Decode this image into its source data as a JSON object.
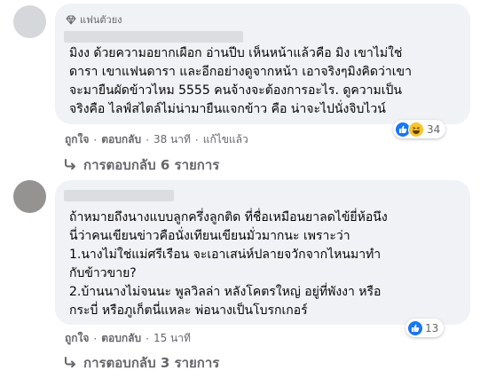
{
  "comments": [
    {
      "badge": "แฟนตัวยง",
      "lines": [
        "มิงง ด้วยความอยากเผือก อ่านปีบ เห็นหน้าแล้วคือ มิง เขาไม่ใช่",
        "ดารา เขาแฟนดารา และอีกอย่างดูจากหน้า เอาจริงๆมิงคิดว่าเขา",
        "จะมายืนผัดข้าวไหม 5555 คนจ้างจะต้องการอะไร. ดูความเป็น",
        "จริงคือ ไลฟ์สไตล์ไม่น่ามายืนแจกข้าว คือ น่าจะไปนั่งจิบไวน์"
      ],
      "like": "ถูกใจ",
      "reply": "ตอบกลับ",
      "time": "38 นาที",
      "edited": "แก้ไขแล้ว",
      "reaction_count": "34",
      "replies_label": "การตอบกลับ 6 รายการ"
    },
    {
      "lines": [
        "ถ้าหมายถึงนางแบบลูกครึ่งลูกติด ที่ชื่อเหมือนยาลดไข้ยี่ห้อนึง",
        "นี่ว่าคนเขียนข่าวคือนั่งเทียนเขียนมั่วมากนะ เพราะว่า",
        "1.นางไม่ใช่แม่ศรีเรือน จะเอาเสน่ห์ปลายจวักจากไหนมาทำ",
        "กับข้าวขาย?",
        "2.บ้านนางไม่จนนะ พูลวิลล่า หลังโคตรใหญ่ อยู่ที่พังงา หรือ",
        "กระบี่ หรือภูเก็ตนี่แหละ พ่อนางเป็นโบรกเกอร์"
      ],
      "like": "ถูกใจ",
      "reply": "ตอบกลับ",
      "time": "15 นาที",
      "reaction_count": "13",
      "replies_label": "การตอบกลับ 3 รายการ"
    }
  ],
  "colors": {
    "bubble": "#f0f2f5",
    "meta": "#65676b",
    "like_blue": "#1877f2"
  },
  "icons": [
    "diamond-icon",
    "like-reaction-icon",
    "haha-reaction-icon",
    "reply-arrow-icon"
  ]
}
